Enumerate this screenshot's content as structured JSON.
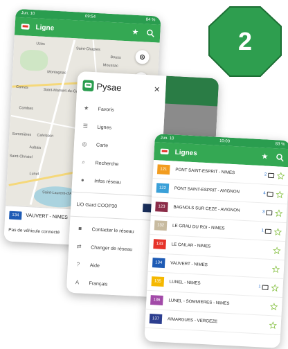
{
  "badge": {
    "number": "2",
    "color": "#2e9e4f"
  },
  "colors": {
    "brand_green": "#34a853",
    "dark_green": "#2a7c45"
  },
  "map_phone": {
    "statusbar": {
      "left": "Jun. 10",
      "center": "09:54",
      "right": "84 %"
    },
    "title": "Ligne",
    "icons": [
      "star-icon",
      "search-icon",
      "location-icon",
      "recenter-icon"
    ],
    "places": [
      "Uzès",
      "Saint-Chaptes",
      "Bouss",
      "Moussac",
      "Montagnac",
      "Carnas",
      "Saint-Mamert-du-Gard",
      "Combas",
      "Sommières",
      "Calvisson",
      "Aubais",
      "Saint-Christol",
      "Lunel",
      "Saint-Laurent-d'Aigouze"
    ],
    "route": {
      "number": "134",
      "name": "VAUVERT - NIMES",
      "color": "#1e5bb5"
    },
    "footer": "Pas de véhicule connecté"
  },
  "drawer_phone": {
    "statusbar": {
      "center": "09:54",
      "right": "84 %"
    },
    "app_name": "Pysae",
    "menu": [
      {
        "label": "Favoris",
        "icon": "star-icon"
      },
      {
        "label": "Lignes",
        "icon": "lines-icon"
      },
      {
        "label": "Carte",
        "icon": "location-icon"
      },
      {
        "label": "Recherche",
        "icon": "search-icon"
      },
      {
        "label": "Infos réseau",
        "icon": "info-icon"
      }
    ],
    "network": "LiO Gard COOP30",
    "menu2": [
      {
        "label": "Contacter le réseau",
        "icon": "mail-icon"
      },
      {
        "label": "Changer de réseau",
        "icon": "switch-icon"
      },
      {
        "label": "Aide",
        "icon": "help-icon"
      },
      {
        "label": "Français",
        "icon": "language-icon"
      }
    ]
  },
  "list_phone": {
    "statusbar": {
      "left": "Jun. 10",
      "center": "10:00",
      "right": "83 %"
    },
    "title": "Lignes",
    "lines": [
      {
        "number": "121",
        "name": "PONT SAINT-ESPRIT - NIMES",
        "count": "2",
        "color": "#f29c1f"
      },
      {
        "number": "122",
        "name": "PONT SAINT-ESPRIT - AVIGNON",
        "count": "4",
        "color": "#3aa0d8"
      },
      {
        "number": "123",
        "name": "BAGNOLS SUR CEZE - AVIGNON",
        "count": "3",
        "color": "#8b2c48"
      },
      {
        "number": "132",
        "name": "LE GRAU DU ROI - NIMES",
        "count": "1",
        "color": "#c8bba0"
      },
      {
        "number": "133",
        "name": "LE CAILAR - NIMES",
        "count": "",
        "color": "#e6332a"
      },
      {
        "number": "134",
        "name": "VAUVERT - NIMES",
        "count": "",
        "color": "#1e5bb5"
      },
      {
        "number": "135",
        "name": "LUNEL - NIMES",
        "count": "1",
        "color": "#f5b800"
      },
      {
        "number": "136",
        "name": "LUNEL - SOMMIERES - NIMES",
        "count": "",
        "color": "#a24aa8"
      },
      {
        "number": "137",
        "name": "AIMARGUES - VERGEZE",
        "count": "",
        "color": "#2c3e8f"
      }
    ]
  }
}
